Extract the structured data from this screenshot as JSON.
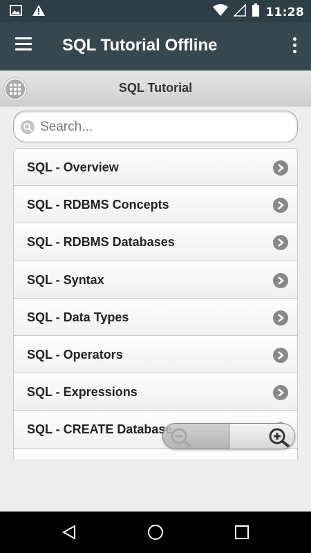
{
  "status_bar": {
    "time": "11:28",
    "icons": [
      "image-icon",
      "warning-icon",
      "wifi-icon",
      "signal-icon",
      "battery-icon"
    ]
  },
  "app_bar": {
    "title": "SQL Tutorial Offline",
    "menu_icon": "hamburger-menu-icon",
    "overflow_icon": "more-vert-icon"
  },
  "sub_header": {
    "title": "SQL Tutorial",
    "grid_icon": "grid-icon"
  },
  "search": {
    "placeholder": "Search...",
    "value": ""
  },
  "list": {
    "items": [
      {
        "label": "SQL - Overview"
      },
      {
        "label": "SQL - RDBMS Concepts"
      },
      {
        "label": "SQL - RDBMS Databases"
      },
      {
        "label": "SQL - Syntax"
      },
      {
        "label": "SQL - Data Types"
      },
      {
        "label": "SQL - Operators"
      },
      {
        "label": "SQL - Expressions"
      },
      {
        "label": "SQL - CREATE Database"
      }
    ]
  },
  "zoom": {
    "out_icon": "zoom-out-icon",
    "in_icon": "zoom-in-icon"
  },
  "nav_bar": {
    "icons": [
      "back-icon",
      "home-icon",
      "recents-icon"
    ]
  },
  "colors": {
    "status_bar": "#2d3e47",
    "app_bar": "#37474f",
    "background": "#eeeeee"
  }
}
